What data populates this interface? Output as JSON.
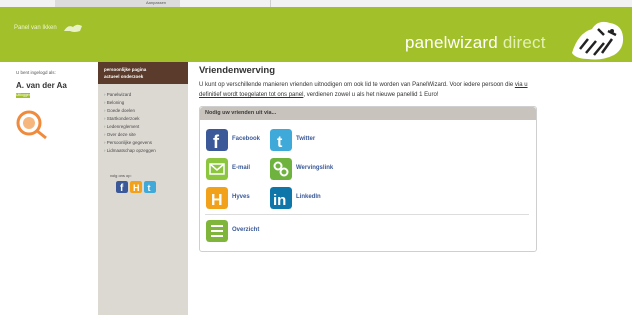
{
  "background_strip": {
    "label": "Aanpassen"
  },
  "header": {
    "left_link": "Panel van Ikken",
    "brand_main": "panelwizard",
    "brand_light": "direct",
    "color": "#a2c02a"
  },
  "user": {
    "logged_in_label": "U bent ingelogd als:",
    "name": "A. van der Aa",
    "status": "Uitloggen"
  },
  "nav": {
    "head_items": [
      "persoonlijke pagina",
      "actueel onderzoek"
    ],
    "items": [
      "Panelwizard",
      "Beloning",
      "Goede doelen",
      "Startkonderzoek",
      "Ledenreglement",
      "Over deze site",
      "Persoonlijke gegevens",
      "Lidmaatschap opzeggen"
    ],
    "follow_label": "volg ons op:"
  },
  "content": {
    "title": "Vriendenwerving",
    "intro_1": "U kunt op verschillende manieren vrienden uitnodigen om ook lid te worden van PanelWizard. Voor iedere persoon die ",
    "intro_link": "via u definitief wordt toegelaten tot ons panel",
    "intro_2": ", verdienen zowel u als het nieuwe panellid 1 Euro!",
    "box_title": "Nodig uw vrienden uit via...",
    "buttons": {
      "facebook": "Facebook",
      "twitter": "Twitter",
      "email": "E-mail",
      "wervingslink": "Wervingslink",
      "hyves": "Hyves",
      "linkedin": "LinkedIn",
      "overzicht": "Overzicht"
    }
  },
  "colors": {
    "facebook": "#3b5998",
    "twitter": "#3fa9d9",
    "email": "#8cc63f",
    "wervingslink": "#6fb33f",
    "hyves": "#f2a21a",
    "linkedin": "#0e76a8",
    "overzicht": "#7fb53a"
  }
}
